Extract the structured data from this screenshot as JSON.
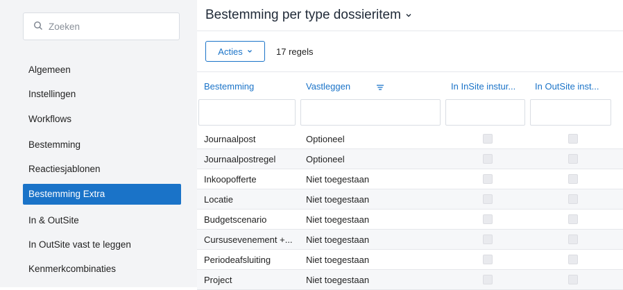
{
  "sidebar": {
    "search_placeholder": "Zoeken",
    "items": [
      {
        "label": "Algemeen",
        "active": false
      },
      {
        "label": "Instellingen",
        "active": false
      },
      {
        "label": "Workflows",
        "active": false
      },
      {
        "label": "Bestemming",
        "active": false
      },
      {
        "label": "Reactiesjablonen",
        "active": false
      },
      {
        "label": "Bestemming Extra",
        "active": true
      },
      {
        "label": "In & OutSite",
        "active": false
      },
      {
        "label": "In OutSite vast te leggen",
        "active": false
      },
      {
        "label": "Kenmerkcombinaties",
        "active": false
      }
    ]
  },
  "main": {
    "title": "Bestemming per type dossieritem",
    "actions_label": "Acties",
    "row_count": "17 regels",
    "columns": [
      "Bestemming",
      "Vastleggen",
      "In InSite instur...",
      "In OutSite inst..."
    ],
    "rows": [
      {
        "bestemming": "Journaalpost",
        "vastleggen": "Optioneel",
        "insite": false,
        "outsite": false
      },
      {
        "bestemming": "Journaalpostregel",
        "vastleggen": "Optioneel",
        "insite": false,
        "outsite": false
      },
      {
        "bestemming": "Inkoopofferte",
        "vastleggen": "Niet toegestaan",
        "insite": false,
        "outsite": false
      },
      {
        "bestemming": "Locatie",
        "vastleggen": "Niet toegestaan",
        "insite": false,
        "outsite": false
      },
      {
        "bestemming": "Budgetscenario",
        "vastleggen": "Niet toegestaan",
        "insite": false,
        "outsite": false
      },
      {
        "bestemming": "Cursusevenement +...",
        "vastleggen": "Niet toegestaan",
        "insite": false,
        "outsite": false
      },
      {
        "bestemming": "Periodeafsluiting",
        "vastleggen": "Niet toegestaan",
        "insite": false,
        "outsite": false
      },
      {
        "bestemming": "Project",
        "vastleggen": "Niet toegestaan",
        "insite": false,
        "outsite": false
      }
    ]
  },
  "colors": {
    "accent": "#1a73c8",
    "sidebar_bg": "#f3f4f6"
  }
}
